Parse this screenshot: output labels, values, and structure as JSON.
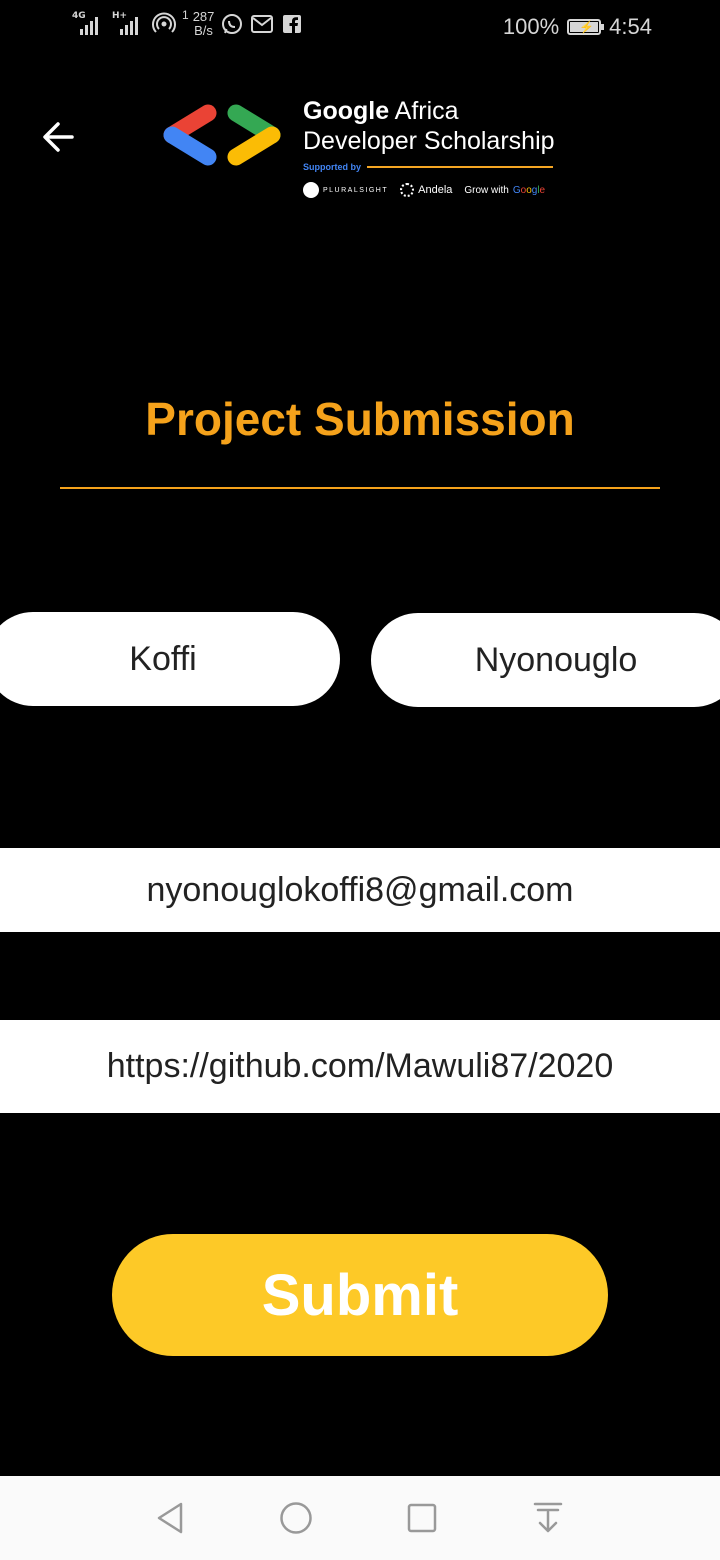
{
  "status_bar": {
    "network1": "4G",
    "network2": "H+",
    "speed_value": "287",
    "speed_unit": "B/s",
    "speed_count": "1",
    "battery_percent": "100%",
    "battery_level": 1.0,
    "time": "4:54"
  },
  "header": {
    "brand_google": "Google",
    "brand_africa": " Africa",
    "brand_line2": "Developer Scholarship",
    "supported_by": "Supported by",
    "sponsor_pluralsight": "PLURALSIGHT",
    "sponsor_andela": "Andela",
    "sponsor_grow": "Grow with ",
    "sponsor_google_letters": [
      "G",
      "o",
      "o",
      "g",
      "l",
      "e"
    ]
  },
  "page": {
    "title": "Project Submission"
  },
  "form": {
    "first_name": "Koffi",
    "last_name": "Nyonouglo",
    "email": "nyonouglokoffi8@gmail.com",
    "github_link": "https://github.com/Mawuli87/2020",
    "submit_label": "Submit"
  },
  "colors": {
    "accent_orange": "#F5A21B",
    "submit_yellow": "#FDC927",
    "background": "#000000"
  },
  "icons": {
    "back": "arrow-left-icon",
    "logo": "gads-chevrons-logo",
    "nav_back": "triangle-back-icon",
    "nav_home": "circle-home-icon",
    "nav_recent": "square-recent-icon",
    "nav_notifications": "pull-down-notifications-icon"
  }
}
